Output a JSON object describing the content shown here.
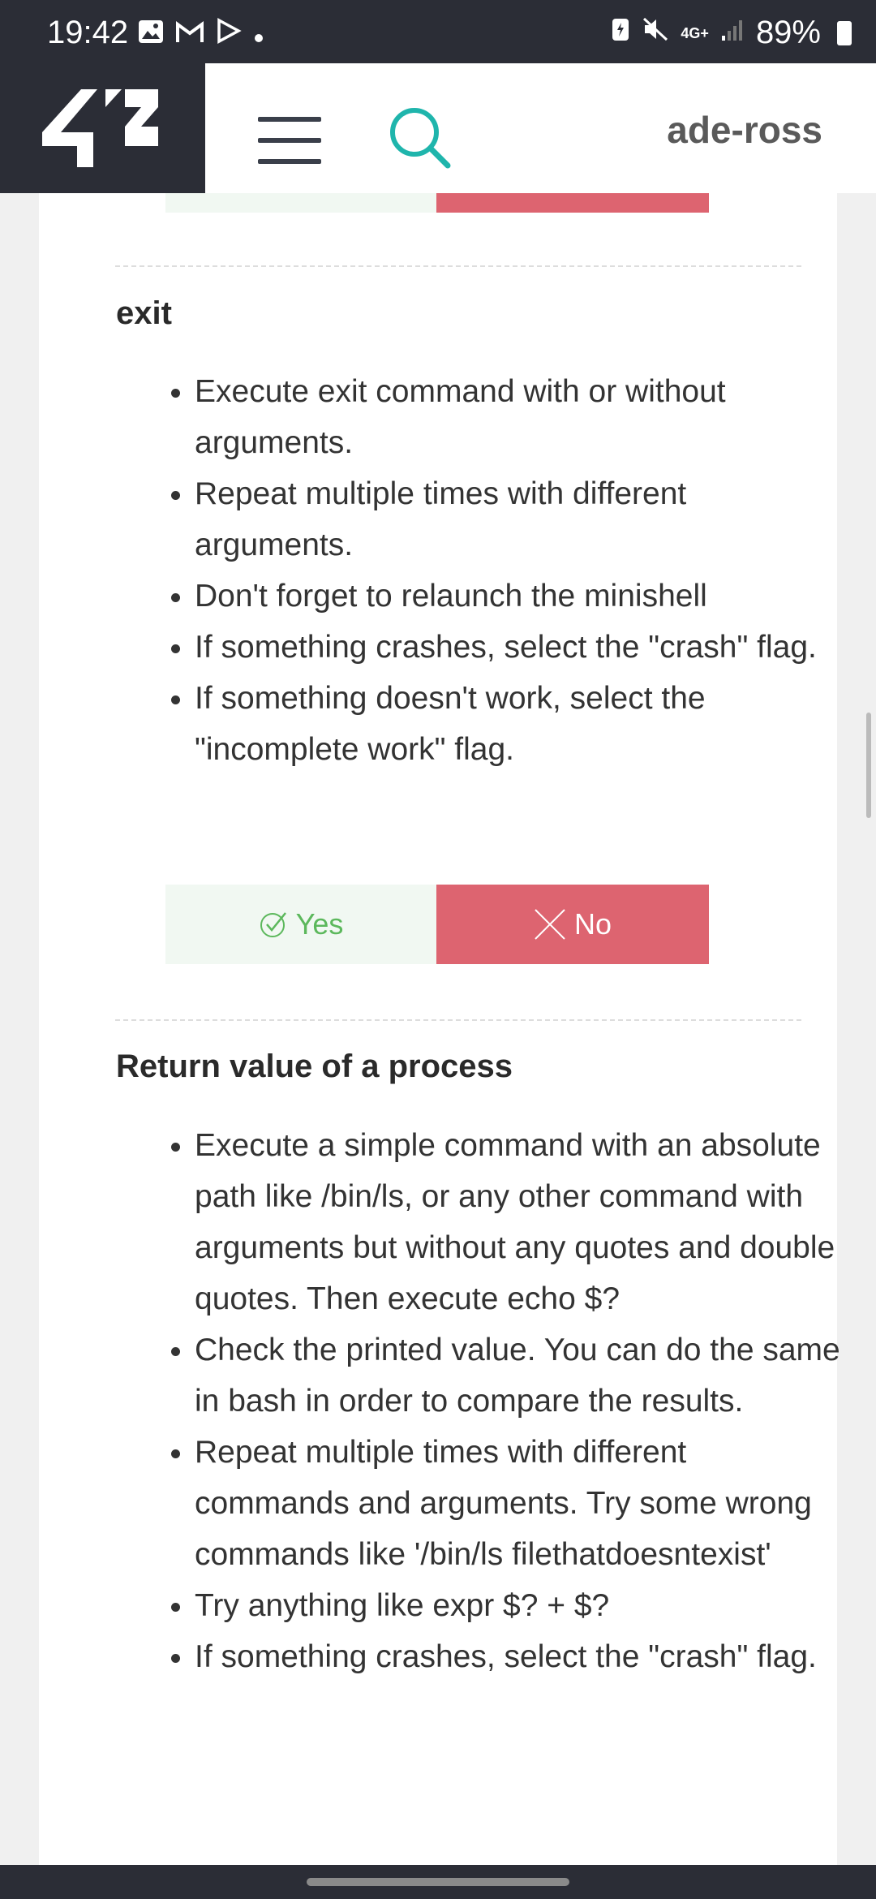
{
  "status_bar": {
    "time": "19:42",
    "notification_icons": [
      "image-icon",
      "gmail-icon",
      "play-store-icon",
      "dot-icon"
    ],
    "system_icons": [
      "battery-saver-icon",
      "mute-icon",
      "network-4g-icon",
      "signal-icon"
    ],
    "network_label": "4G+",
    "battery": "89%"
  },
  "header": {
    "logo_text": "42",
    "username": "ade-ross"
  },
  "sections": [
    {
      "title": "exit",
      "items": [
        "Execute exit command with or without arguments.",
        "Repeat multiple times with different arguments.",
        "Don't forget to relaunch the minishell",
        "If something crashes, select the \"crash\" flag.",
        "If something doesn't work, select the \"incomplete work\" flag."
      ],
      "yes_label": "Yes",
      "no_label": "No"
    },
    {
      "title": "Return value of a process",
      "items": [
        "Execute a simple command with an absolute path like /bin/ls, or any other command with arguments but without any quotes and double quotes. Then execute echo $?",
        "Check the printed value. You can do the same in bash in order to compare the results.",
        "Repeat multiple times with different commands and arguments. Try some wrong commands like '/bin/ls filethatdoesntexist'",
        "Try anything like expr $? + $?",
        "If something crashes, select the \"crash\" flag."
      ]
    }
  ],
  "colors": {
    "header_dark": "#2b2d36",
    "accent_teal": "#1fb5ac",
    "yes_green": "#5cb85c",
    "no_red": "#dd6470"
  }
}
